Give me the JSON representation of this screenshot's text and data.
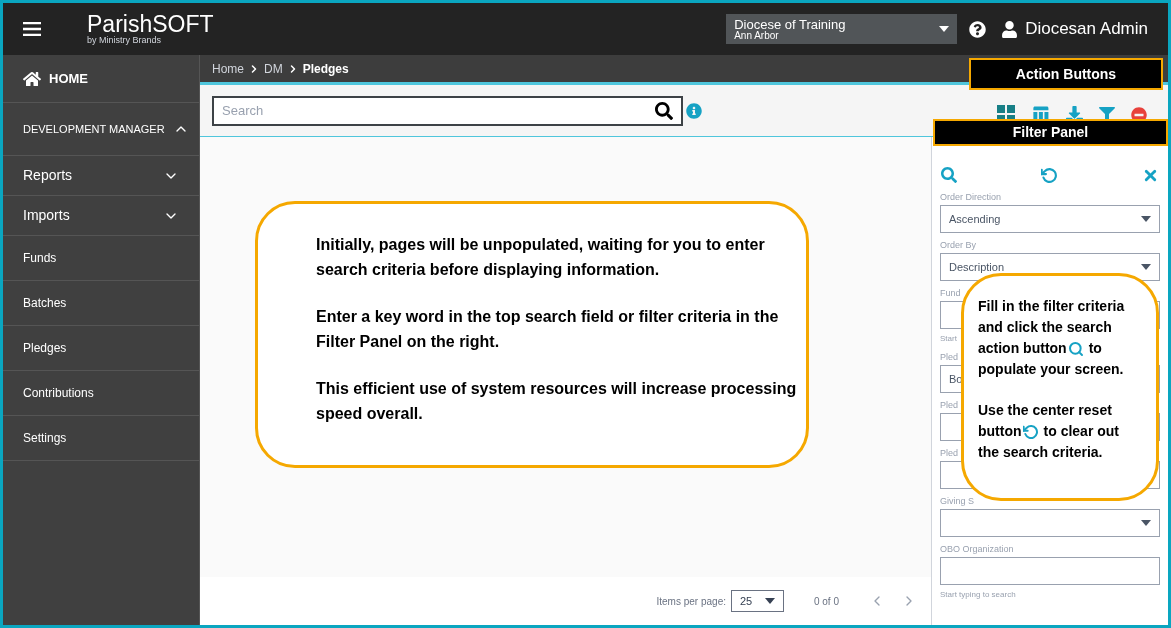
{
  "header": {
    "logo": {
      "name": "ParishSOFT",
      "tagline": "by Ministry Brands"
    },
    "organization": {
      "name": "Diocese of Training",
      "location": "Ann Arbor"
    },
    "user": "Diocesan Admin"
  },
  "sidebar": {
    "items": [
      {
        "kind": "home",
        "label": "HOME"
      },
      {
        "kind": "group",
        "label": "DEVELOPMENT MANAGER",
        "expanded": true
      },
      {
        "kind": "group",
        "label": "Reports",
        "expanded": false
      },
      {
        "kind": "group",
        "label": "Imports",
        "expanded": false
      },
      {
        "kind": "link",
        "label": "Funds"
      },
      {
        "kind": "link",
        "label": "Batches"
      },
      {
        "kind": "link",
        "label": "Pledges"
      },
      {
        "kind": "link",
        "label": "Contributions"
      },
      {
        "kind": "link",
        "label": "Settings"
      }
    ]
  },
  "breadcrumb": [
    {
      "label": "Home",
      "current": false
    },
    {
      "label": "DM",
      "current": false
    },
    {
      "label": "Pledges",
      "current": true
    }
  ],
  "search": {
    "placeholder": "Search"
  },
  "annotations": {
    "action_buttons": "Action Buttons",
    "filter_panel": "Filter Panel"
  },
  "main_callout": [
    "Initially, pages will be unpopulated, waiting for you to enter search criteria before displaying information.",
    "Enter a key word in the top search field or filter criteria in the Filter Panel on the right.",
    "This efficient use of system resources will increase processing speed overall."
  ],
  "filter_callout": [
    [
      {
        "text": "Fill in the filter criteria"
      },
      {
        "text": "and click the search"
      },
      {
        "text": "action button",
        "after": "to"
      },
      {
        "text": "populate your screen."
      }
    ],
    [
      {
        "text": "Use the center reset"
      },
      {
        "text": "button",
        "after": "to clear out"
      },
      {
        "text": "the search criteria."
      }
    ]
  ],
  "filter_fields": [
    {
      "kind": "select",
      "label": "Order Direction",
      "value": "Ascending"
    },
    {
      "kind": "select",
      "label": "Order By",
      "value": "Description"
    },
    {
      "kind": "text",
      "label": "Fund",
      "hint": "Start"
    },
    {
      "kind": "text",
      "label": "Pled",
      "value": "Bo"
    },
    {
      "kind": "text",
      "label": "Pled"
    },
    {
      "kind": "text",
      "label": "Pled"
    },
    {
      "kind": "select",
      "label": "Giving S"
    },
    {
      "kind": "text",
      "label": "OBO Organization",
      "hint": "Start typing to search"
    }
  ],
  "pagination": {
    "label": "Items per page:",
    "page_size": "25",
    "range": "0 of 0"
  }
}
